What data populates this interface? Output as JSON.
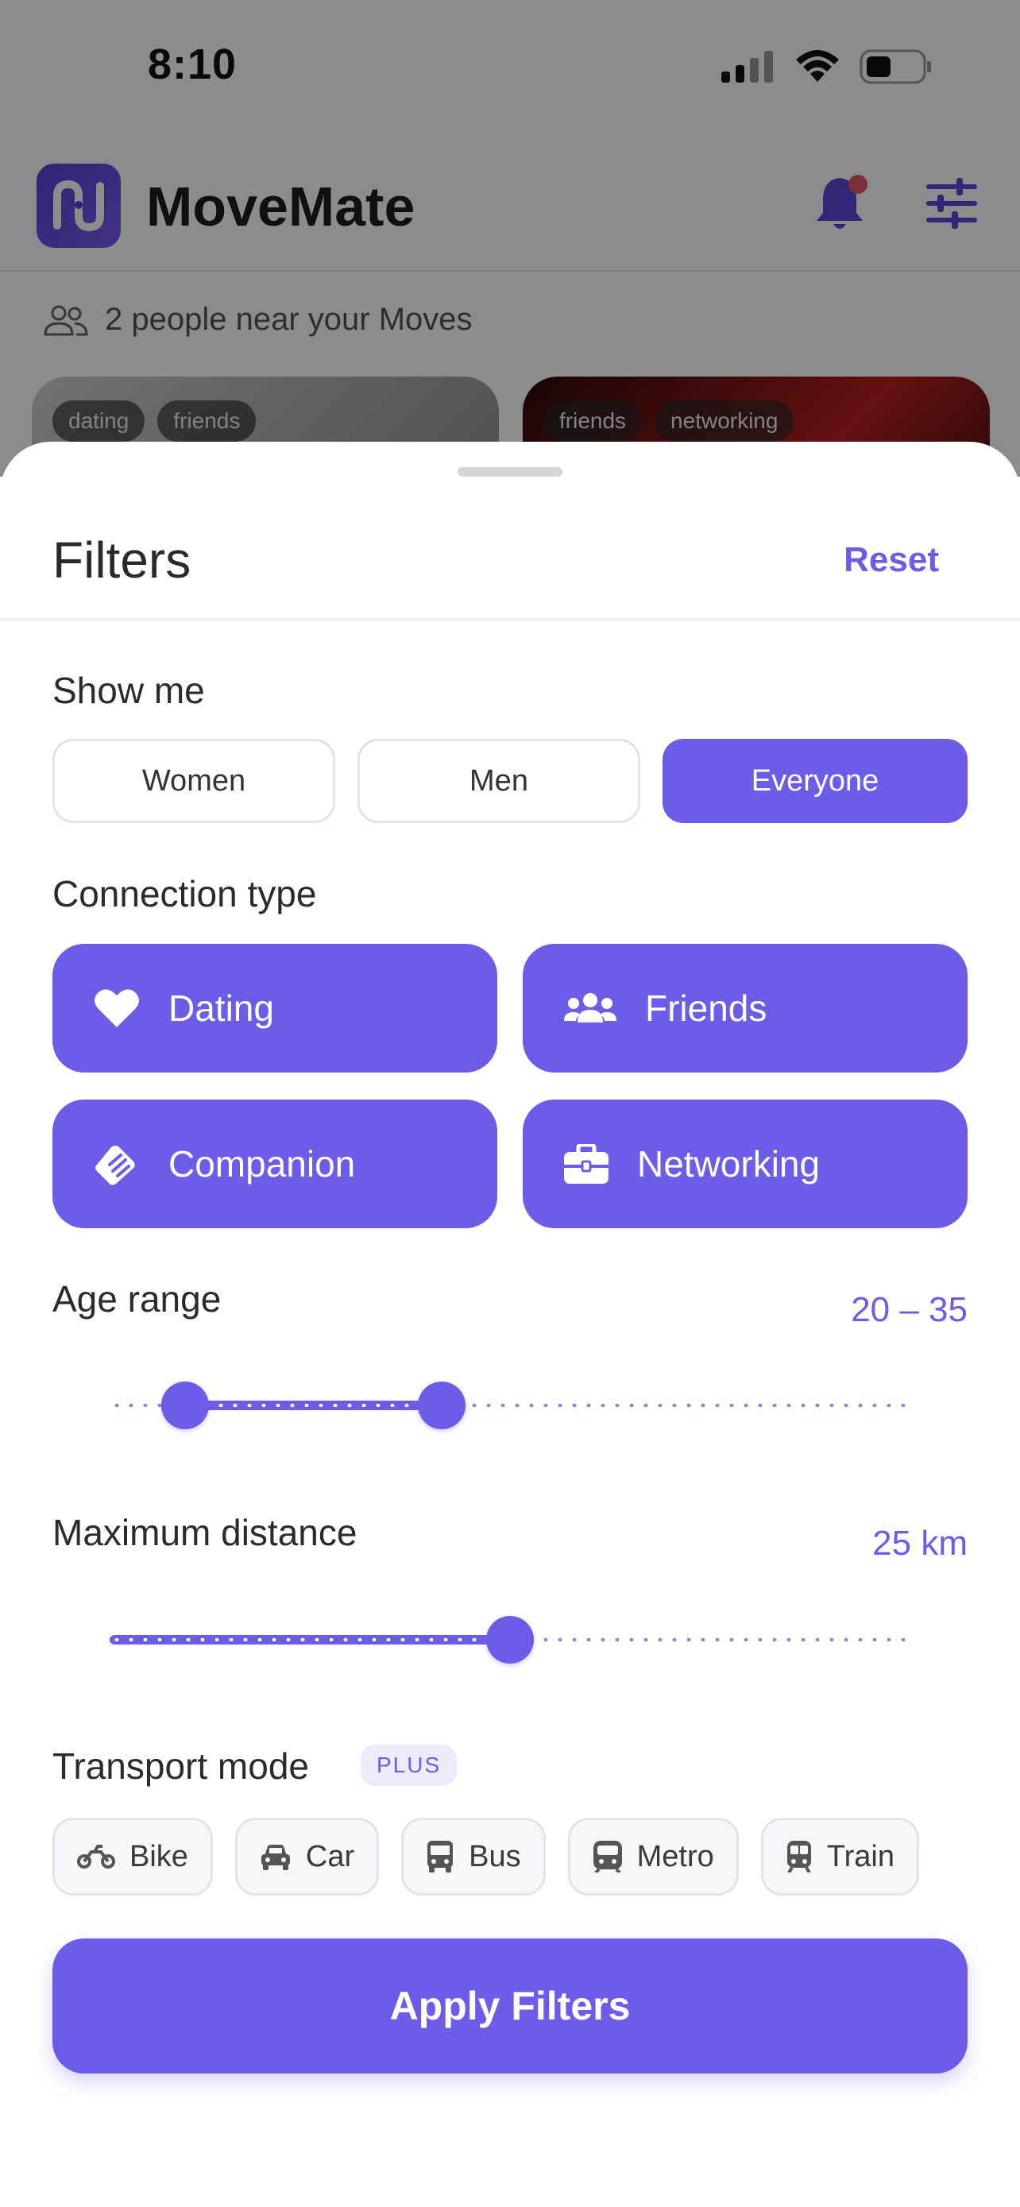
{
  "status_bar": {
    "time": "8:10"
  },
  "app": {
    "title": "MoveMate",
    "nearby_text": "2 people near your Moves"
  },
  "cards": [
    {
      "tags": [
        "dating",
        "friends"
      ]
    },
    {
      "tags": [
        "friends",
        "networking"
      ]
    }
  ],
  "filters": {
    "title": "Filters",
    "reset_label": "Reset",
    "show_me": {
      "label": "Show me",
      "options": [
        "Women",
        "Men",
        "Everyone"
      ],
      "selected": "Everyone"
    },
    "connection_type": {
      "label": "Connection type",
      "options": [
        {
          "label": "Dating",
          "icon": "heart-icon"
        },
        {
          "label": "Friends",
          "icon": "people-icon"
        },
        {
          "label": "Companion",
          "icon": "handshake-icon"
        },
        {
          "label": "Networking",
          "icon": "briefcase-icon"
        }
      ]
    },
    "age_range": {
      "label": "Age range",
      "value_text": "20 – 35",
      "min": 20,
      "max": 35,
      "scale_min": 18,
      "scale_max": 60
    },
    "max_distance": {
      "label": "Maximum distance",
      "value_text": "25 km",
      "value": 25,
      "scale_min": 0,
      "scale_max": 50
    },
    "transport_mode": {
      "label": "Transport mode",
      "badge": "PLUS",
      "options": [
        {
          "label": "Bike",
          "icon": "motorbike-icon"
        },
        {
          "label": "Car",
          "icon": "car-icon"
        },
        {
          "label": "Bus",
          "icon": "bus-icon"
        },
        {
          "label": "Metro",
          "icon": "metro-icon"
        },
        {
          "label": "Train",
          "icon": "train-icon"
        }
      ]
    },
    "apply_label": "Apply Filters"
  },
  "colors": {
    "accent": "#6c5ce7",
    "notification_dot": "#e0566a"
  }
}
